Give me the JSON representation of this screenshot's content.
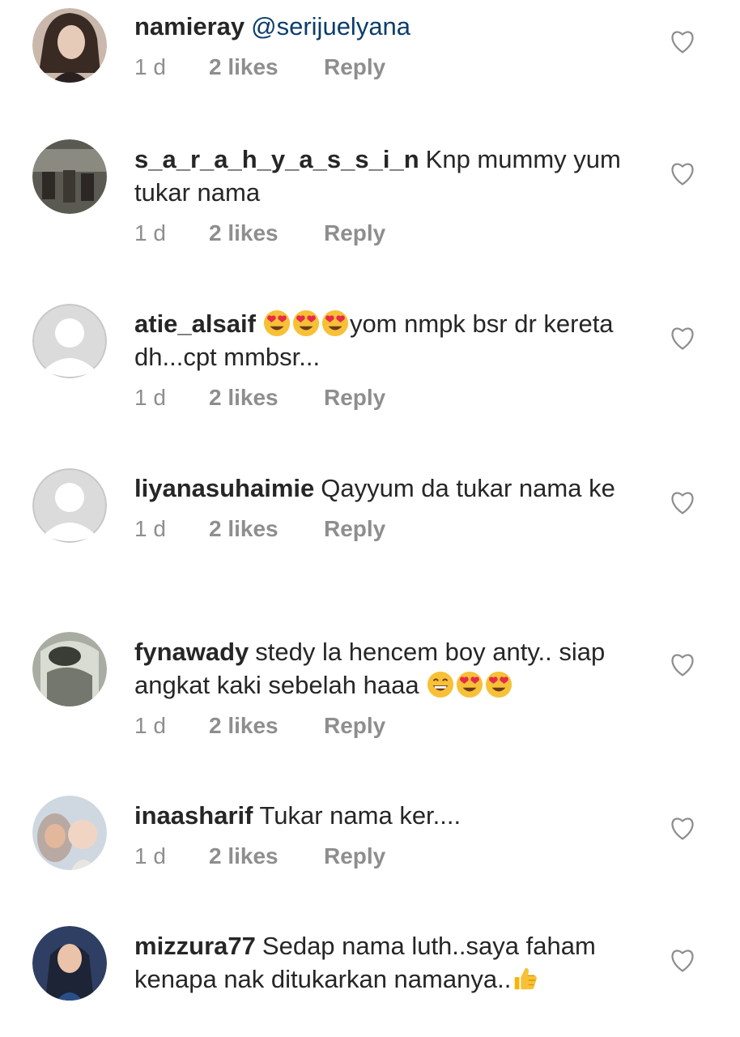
{
  "comments": [
    {
      "username": "namieray",
      "mention": "@serijuelyana",
      "text": "",
      "time": "1 d",
      "likes": "2 likes",
      "reply": "Reply",
      "avatar": "photo-avatar",
      "like_icon": "heart-outline-icon"
    },
    {
      "username": "s_a_r_a_h_y_a_s_s_i_n",
      "text": "Knp mummy yum tukar nama",
      "time": "1 d",
      "likes": "2 likes",
      "reply": "Reply",
      "avatar": "photo-avatar",
      "like_icon": "heart-outline-icon"
    },
    {
      "username": "atie_alsaif",
      "emoji_before": [
        "smiling-face-with-heart-eyes",
        "smiling-face-with-heart-eyes",
        "smiling-face-with-heart-eyes"
      ],
      "text": "yom nmpk bsr dr kereta dh...cpt mmbsr...",
      "time": "1 d",
      "likes": "2 likes",
      "reply": "Reply",
      "avatar": "default-avatar",
      "like_icon": "heart-outline-icon"
    },
    {
      "username": "liyanasuhaimie",
      "text": "Qayyum da tukar nama ke",
      "time": "1 d",
      "likes": "2 likes",
      "reply": "Reply",
      "avatar": "default-avatar",
      "like_icon": "heart-outline-icon"
    },
    {
      "username": "fynawady",
      "text": "stedy la hencem boy anty.. siap angkat kaki sebelah haaa",
      "emoji_after": [
        "grinning-face-with-smiling-eyes",
        "smiling-face-with-heart-eyes",
        "smiling-face-with-heart-eyes"
      ],
      "time": "1 d",
      "likes": "2 likes",
      "reply": "Reply",
      "avatar": "photo-avatar",
      "like_icon": "heart-outline-icon"
    },
    {
      "username": "inaasharif",
      "text": "Tukar nama ker....",
      "time": "1 d",
      "likes": "2 likes",
      "reply": "Reply",
      "avatar": "photo-avatar",
      "like_icon": "heart-outline-icon"
    },
    {
      "username": "mizzura77",
      "text": "Sedap nama luth..saya faham kenapa nak ditukarkan namanya..",
      "emoji_after": [
        "thumbs-up"
      ],
      "time": "",
      "likes": "",
      "reply": "",
      "avatar": "photo-avatar",
      "like_icon": "heart-outline-icon"
    }
  ],
  "colors": {
    "text": "#262626",
    "meta": "#8e8e8e",
    "mention": "#0c3d6b",
    "heart_outline": "#8e8e8e",
    "default_avatar_bg": "#dbdbdb"
  }
}
